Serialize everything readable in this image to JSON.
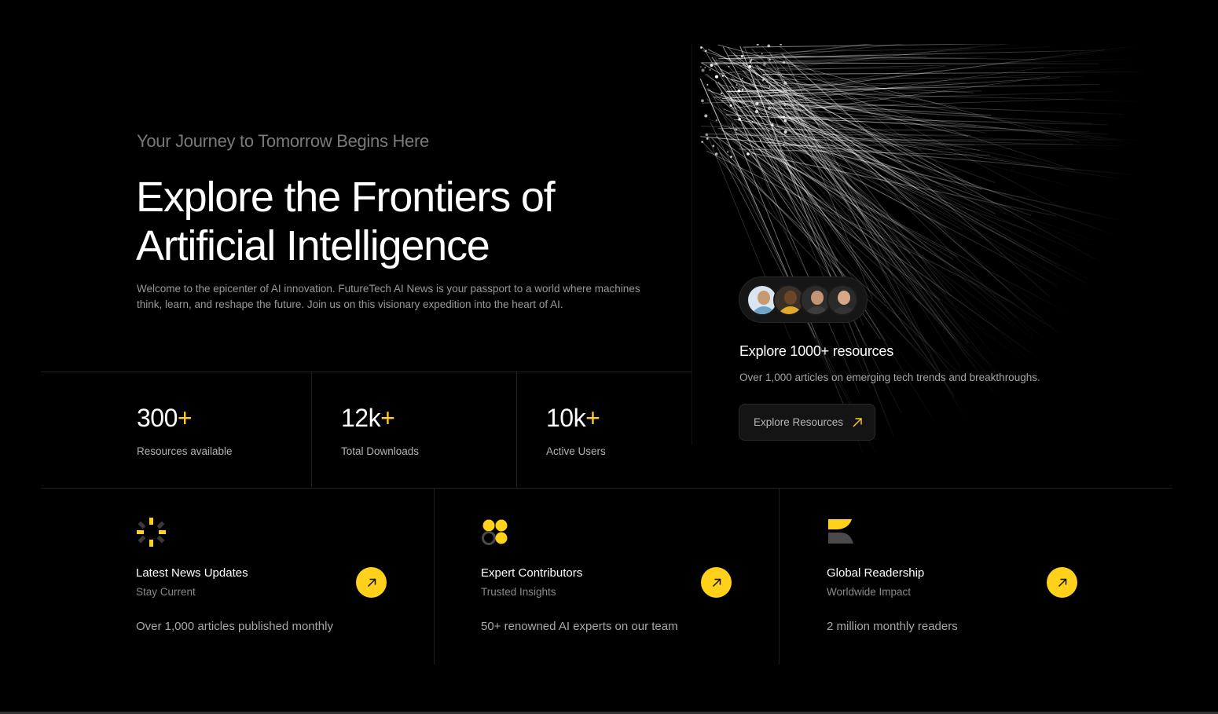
{
  "hero": {
    "eyebrow": "Your Journey to Tomorrow Begins Here",
    "headline_line1": "Explore the Frontiers of",
    "headline_line2": "Artificial Intelligence",
    "intro": "Welcome to the epicenter of AI innovation. FutureTech AI News is your passport to a world where machines think, learn, and reshape the future. Join us on this visionary expedition into the heart of AI."
  },
  "stats": [
    {
      "value": "300",
      "suffix": "+",
      "label": "Resources available"
    },
    {
      "value": "12k",
      "suffix": "+",
      "label": "Total Downloads"
    },
    {
      "value": "10k",
      "suffix": "+",
      "label": "Active Users"
    }
  ],
  "resources": {
    "avatar_icons": [
      "avatar-1",
      "avatar-2",
      "avatar-3",
      "avatar-4"
    ],
    "title": "Explore 1000+ resources",
    "subtitle": "Over 1,000 articles on emerging tech trends and breakthroughs.",
    "button_label": "Explore Resources",
    "button_icon": "arrow-up-right-icon"
  },
  "features": [
    {
      "icon": "sparkle-burst-icon",
      "title": "Latest News Updates",
      "subtitle": "Stay Current",
      "description": "Over 1,000 articles published monthly"
    },
    {
      "icon": "clover-icon",
      "title": "Expert Contributors",
      "subtitle": "Trusted Insights",
      "description": "50+ renowned AI experts on our team"
    },
    {
      "icon": "stacked-leaf-icon",
      "title": "Global Readership",
      "subtitle": "Worldwide Impact",
      "description": "2 million monthly readers"
    }
  ],
  "colors": {
    "background": "#000000",
    "accent": "#ffd11a",
    "muted_text": "#98989a",
    "divider": "#1f1f1f"
  }
}
